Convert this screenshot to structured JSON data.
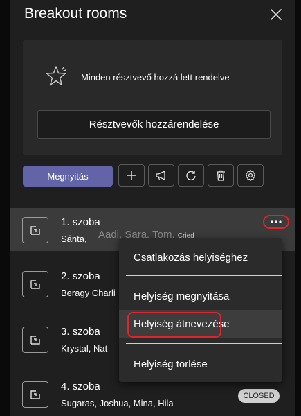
{
  "header": {
    "title": "Breakout rooms"
  },
  "status": {
    "message": "Minden résztvevő hozzá lett rendelve",
    "assign_label": "Résztvevők hozzárendelése"
  },
  "toolbar": {
    "open_label": "Megnyitás",
    "icons": [
      "plus-icon",
      "announce-icon",
      "recreate-icon",
      "delete-icon",
      "settings-icon"
    ]
  },
  "rooms": [
    {
      "name": "1. szoba",
      "members": "Sánta,",
      "faded_members": "Aadi, Sara, Tom,",
      "faded_extra": "Cried"
    },
    {
      "name": "2. szoba",
      "members": "Beragy Charli"
    },
    {
      "name": "3. szoba",
      "members": "Krystal, Nat"
    },
    {
      "name": "4. szoba",
      "members": "Sugaras, Joshua, Mina, Hila",
      "badge": "CLOSED"
    }
  ],
  "context_menu": {
    "items": [
      "Csatlakozás helyiséghez",
      "Helyiség megnyitása",
      "Helyiség átnevezése",
      "Helyiség törlése"
    ]
  },
  "colors": {
    "accent": "#6264a7",
    "highlight_outline": "#e0242b",
    "panel_bg": "#1f1f1f"
  }
}
